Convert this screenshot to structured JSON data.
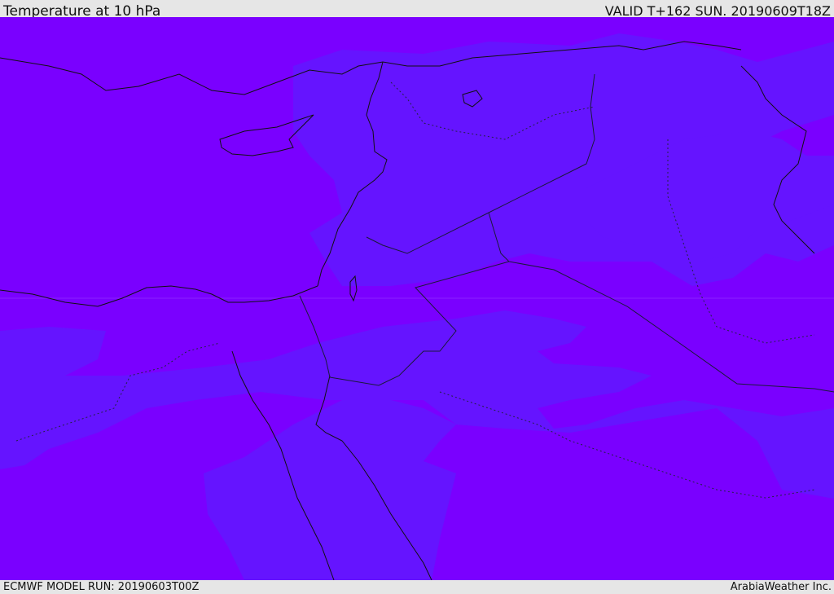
{
  "header": {
    "title": "Temperature at 10 hPa",
    "valid": "VALID T+162 SUN. 20190609T18Z"
  },
  "footer": {
    "model_run": "ECMWF MODEL RUN: 20190603T00Z",
    "credit": "ArabiaWeather Inc."
  },
  "map": {
    "field": "temperature",
    "level": "10 hPa",
    "colors": {
      "warm_band": "#7a00ff",
      "cool_band": "#6514ff",
      "coastline": "#111111",
      "border": "#222244"
    }
  }
}
